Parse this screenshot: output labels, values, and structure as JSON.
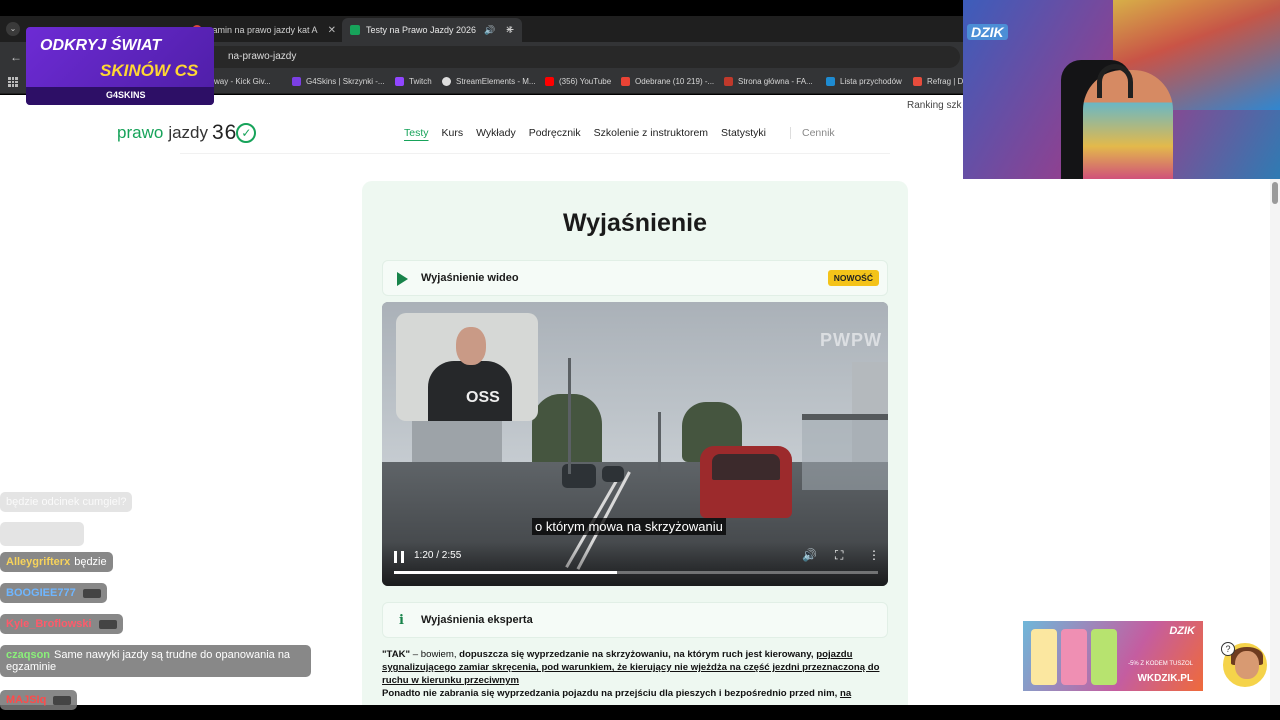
{
  "browser": {
    "tabs": [
      {
        "title": "zamin na prawo jazdy kat A",
        "favicon_color": "#d9473e",
        "active": false
      },
      {
        "title": "Testy na Prawo Jazdy 2026",
        "favicon_color": "#17a35a",
        "active": true
      }
    ],
    "url": "na-prawo-jazdy",
    "bookmarks": [
      {
        "label": "way - Kick Giv...",
        "color": "#3bb54a"
      },
      {
        "label": "G4Skins | Skrzynki -...",
        "color": "#7b3fe4"
      },
      {
        "label": "Twitch",
        "color": "#9146ff"
      },
      {
        "label": "StreamElements - M...",
        "color": "#dddddd"
      },
      {
        "label": "(356) YouTube",
        "color": "#ff0000"
      },
      {
        "label": "Odebrane (10 219) -...",
        "color": "#ea4335"
      },
      {
        "label": "Strona główna - FA...",
        "color": "#c0392b"
      },
      {
        "label": "Lista przychodów",
        "color": "#1e8bd1"
      },
      {
        "label": "Refrag | D",
        "color": "#e74c3c"
      }
    ]
  },
  "site": {
    "ranking_text": "Ranking szk",
    "logo": {
      "word1": "prawo",
      "word2": "jazdy",
      "num": "36"
    },
    "nav": [
      {
        "label": "Testy",
        "active": true
      },
      {
        "label": "Kurs"
      },
      {
        "label": "Wykłady"
      },
      {
        "label": "Podręcznik"
      },
      {
        "label": "Szkolenie z instruktorem"
      },
      {
        "label": "Statystyki"
      }
    ],
    "nav_pricing": "Cennik"
  },
  "explanation": {
    "title": "Wyjaśnienie",
    "video_section_label": "Wyjaśnienie wideo",
    "new_badge": "NOWOŚĆ",
    "video": {
      "watermark": "PWPW",
      "presenter_logo": "OSS",
      "subtitle": "o którym mowa na skrzyżowaniu",
      "timecode": "1:20 / 2:55",
      "progress_fraction": 0.46
    },
    "expert_section_label": "Wyjaśnienia eksperta",
    "answer": {
      "lead": "\"TAK\"",
      "lead_rest": " – bowiem, ",
      "bold1": "dopuszcza się wyprzedzanie na skrzyżowaniu, na którym ruch jest kierowany,",
      "underline1": "pojazdu sygnalizującego zamiar skręcenia, pod warunkiem, że kierujący nie wjeżdża na część jezdni przeznaczoną do ruchu w kierunku przeciwnym",
      "line2": "Ponadto nie zabrania się wyprzedzania pojazdu na przejściu dla pieszych i bezpośrednio przed nim,",
      "line2_tail": "na"
    }
  },
  "overlays": {
    "promo": {
      "line1": "ODKRYJ ŚWIAT",
      "line2": "SKINÓW CS",
      "brand": "G4SKINS"
    },
    "webcam_badge": "DZIK",
    "chat": [
      {
        "user": "",
        "text": "będzie odcinek cumgiel?",
        "faded": true
      },
      {
        "user": "",
        "text": "",
        "faded": true
      },
      {
        "user": "Alleygrifterx",
        "text": "będzie",
        "color": "#f7d35b"
      },
      {
        "user": "BOOGIEE777",
        "text": "",
        "color": "#6fb6ff"
      },
      {
        "user": "Kyle_Broflowski",
        "text": "",
        "color": "#ff5a6a"
      },
      {
        "user": "czaqson",
        "text": "Same nawyki jazdy są trudne do opanowania na egzaminie",
        "color": "#8af07a"
      },
      {
        "user": "MAJSIq",
        "text": "",
        "color": "#ff4a4a"
      }
    ],
    "ad": {
      "brand": "DZIK",
      "code": "-5% Z KODEM TUSZOL",
      "site": "WKDZIK.PL"
    },
    "help_badge": "?"
  }
}
